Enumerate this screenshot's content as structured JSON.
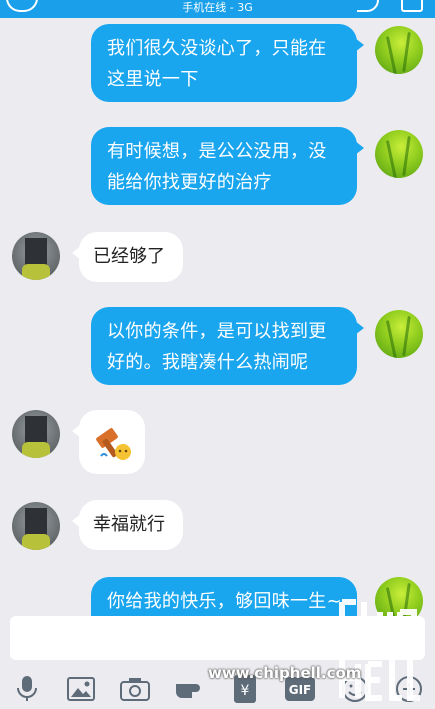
{
  "status_bar": {
    "network": "手机在线 - 3G"
  },
  "messages": [
    {
      "side": "out",
      "text": "我们很久没谈心了，只能在这里说一下"
    },
    {
      "side": "out",
      "text": "有时候想，是公公没用，没能给你找更好的治疗"
    },
    {
      "side": "in",
      "text": "已经够了"
    },
    {
      "side": "out",
      "text": "以你的条件，是可以找到更好的。我瞎凑什么热闹呢"
    },
    {
      "side": "in",
      "type": "sticker",
      "sticker": "hammer-sticker"
    },
    {
      "side": "in",
      "text": "幸福就行"
    },
    {
      "side": "out",
      "text": "你给我的快乐，够回味一生~"
    }
  ],
  "input": {
    "placeholder": ""
  },
  "toolbar": {
    "icons": [
      "microphone-icon",
      "image-icon",
      "camera-icon",
      "gesture-icon",
      "red-packet-icon",
      "gif-icon",
      "emoji-icon",
      "more-icon"
    ],
    "gif_label": "GIF",
    "money_label": "¥"
  },
  "watermark": {
    "url": "www.chiphell.com",
    "logo": "chip hell"
  },
  "colors": {
    "accent": "#1aa0ea",
    "bubble_out": "#1aa5ef",
    "background": "#ececf0"
  }
}
